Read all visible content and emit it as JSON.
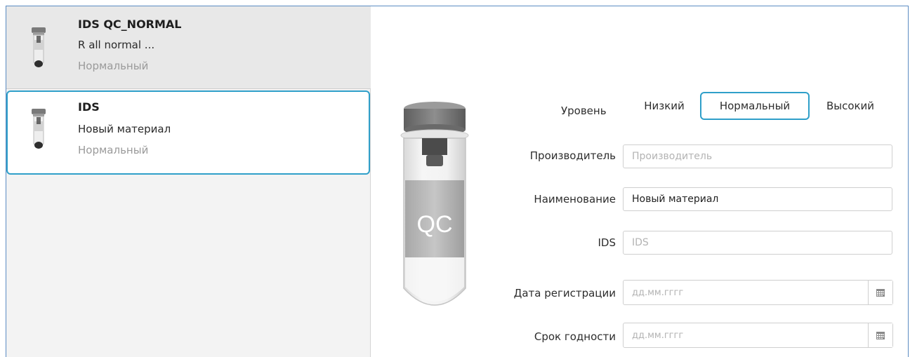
{
  "materials": [
    {
      "title": "IDS QC_NORMAL",
      "subtitle": "R all normal ...",
      "level": "Нормальный"
    },
    {
      "title": "IDS",
      "subtitle": "Новый материал",
      "level": "Нормальный"
    }
  ],
  "tube": {
    "label": "QC"
  },
  "form": {
    "level_label": "Уровень",
    "levels": [
      "Низкий",
      "Нормальный",
      "Высокий"
    ],
    "selected_level": "Нормальный",
    "manufacturer": {
      "label": "Производитель",
      "placeholder": "Производитель",
      "value": ""
    },
    "name": {
      "label": "Наименование",
      "placeholder": "",
      "value": "Новый материал"
    },
    "ids": {
      "label": "IDS",
      "placeholder": "IDS",
      "value": ""
    },
    "registration_date": {
      "label": "Дата регистрации",
      "placeholder": "дд.мм.гггг",
      "value": ""
    },
    "expiry_date": {
      "label": "Срок годности",
      "placeholder": "дд.мм.гггг",
      "value": ""
    }
  },
  "icons": [
    "small-tube-icon",
    "calendar-icon"
  ],
  "colors": {
    "selection_border": "#2f9fc9",
    "window_border": "#5b8bc2"
  }
}
